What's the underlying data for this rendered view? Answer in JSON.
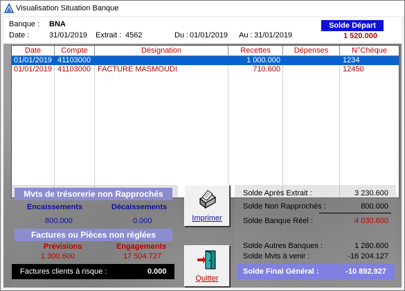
{
  "window": {
    "title": "Visualisation Situation Banque"
  },
  "header": {
    "banque_label": "Banque :",
    "banque_value": "BNA",
    "date_label": "Date :",
    "date_value": "31/01/2019",
    "extrait_label": "Extrait :",
    "extrait_value": "4562",
    "du_label": "Du :",
    "du_value": "01/01/2019",
    "au_label": "Au :",
    "au_value": "31/01/2019",
    "solde_depart_label": "Solde Départ",
    "solde_depart_value": "1 520.000"
  },
  "grid": {
    "columns": [
      "Date",
      "Compte",
      "Désignation",
      "Recettes",
      "Dépenses",
      "N°Chèque"
    ],
    "rows": [
      {
        "date": "01/01/2019",
        "compte": "41103000",
        "designation": "",
        "recettes": "1 000.000",
        "depenses": "",
        "cheque": "1234",
        "selected": true
      },
      {
        "date": "01/01/2019",
        "compte": "41103000",
        "designation": "FACTURE MASMOUDI",
        "recettes": "710.600",
        "depenses": "",
        "cheque": "12450",
        "selected": false
      }
    ]
  },
  "mvts": {
    "title": "Mvts de trésorerie non Rapprochés",
    "encaissements_label": "Encaissements",
    "decaissements_label": "Décaissements",
    "encaissements_value": "800.000",
    "decaissements_value": "0.000"
  },
  "factures": {
    "title": "Factures ou Pièces  non règlées",
    "previsions_label": "Prévisions",
    "engagements_label": "Engagements",
    "previsions_value": "1 300.600",
    "engagements_value": "17 504.727"
  },
  "risque": {
    "label": "Factures clients à risque :",
    "value": "0.000"
  },
  "buttons": {
    "imprimer": "Imprimer",
    "quitter": "Quitter"
  },
  "summary": {
    "apres_extrait_label": "Solde Après Extrait :",
    "apres_extrait_value": "3 230.600",
    "non_rapproches_label": "Solde Non Rapprochés :",
    "non_rapproches_value": "800.000",
    "banque_reel_label": "Solde Banque Réel :",
    "banque_reel_value": "4 030.600",
    "autres_banques_label": "Solde Autres Banques :",
    "autres_banques_value": "1 280.600",
    "mvts_venir_label": "Solde Mvts à venir :",
    "mvts_venir_value": "-16 204.127",
    "final_label": "Solde Final Général :",
    "final_value": "-10 892.927"
  },
  "colors": {
    "header_blue": "#1010d8",
    "selection": "#0a62d0",
    "red_text": "#c00000",
    "section_header": "#8c8cd0",
    "final_bar": "#8080e0"
  }
}
